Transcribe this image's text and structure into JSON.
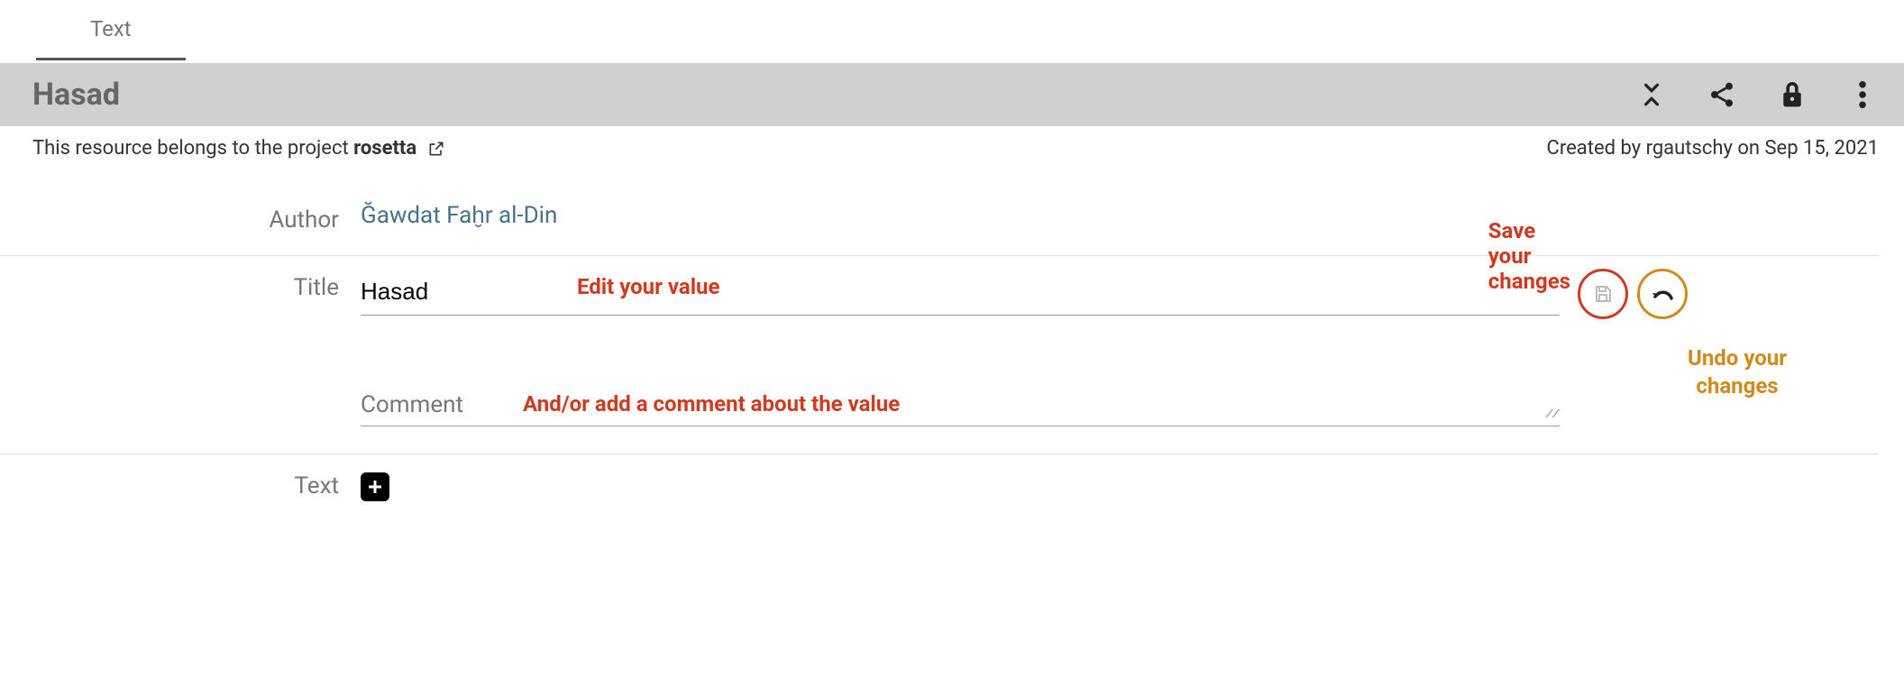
{
  "tabs": {
    "text": "Text"
  },
  "header": {
    "title": "Hasad"
  },
  "meta": {
    "belongs_prefix": "This resource belongs to the project ",
    "project_name": "rosetta",
    "created": "Created by rgautschy on Sep 15, 2021"
  },
  "form": {
    "author_label": "Author",
    "author_value": "Ğawdat Faḫr al-Din",
    "title_label": "Title",
    "title_value": "Hasad",
    "comment_label": "Comment",
    "comment_value": "",
    "text_label": "Text"
  },
  "annotations": {
    "edit": "Edit your value",
    "save": "Save your changes",
    "comment": "And/or add a comment about the value",
    "undo_line1": "Undo your",
    "undo_line2": "changes"
  }
}
